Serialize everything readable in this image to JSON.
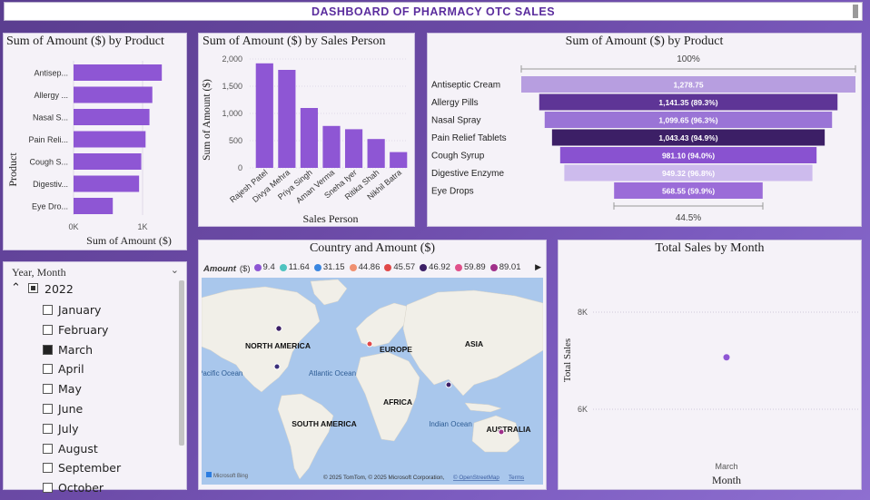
{
  "dashboard_title": "DASHBOARD OF PHARMACY OTC SALES",
  "bar_product": {
    "title": "Sum of Amount ($) by Product",
    "ylabel": "Product",
    "xlabel": "Sum of Amount ($)",
    "ticks": [
      "0K",
      "1K"
    ],
    "categories": [
      "Antisep...",
      "Allergy ...",
      "Nasal S...",
      "Pain Reli...",
      "Cough S...",
      "Digestiv...",
      "Eye Dro..."
    ],
    "values": [
      1278.75,
      1141.35,
      1099.65,
      1043.43,
      981.1,
      949.32,
      568.55
    ],
    "color": "#8e56d4"
  },
  "bar_salesperson": {
    "title": "Sum of Amount ($) by Sales Person",
    "ylabel": "Sum of Amount ($)",
    "xlabel": "Sales Person",
    "yticks": [
      "2,000",
      "1,500",
      "1,000",
      "500",
      "0"
    ],
    "categories": [
      "Rajesh Patel",
      "Divya Mehra",
      "Priya Singh",
      "Aman Verma",
      "Sneha Iyer",
      "Ritika Shah",
      "Nikhil Batra"
    ],
    "values": [
      1920,
      1800,
      1100,
      770,
      710,
      530,
      290
    ],
    "color": "#8e56d4"
  },
  "funnel": {
    "title": "Sum of Amount ($) by Product",
    "top_label": "100%",
    "bottom_label": "44.5%",
    "items": [
      {
        "name": "Antiseptic Cream",
        "label": "1,278.75",
        "value": 1278.75,
        "color": "#b79ee0"
      },
      {
        "name": "Allergy Pills",
        "label": "1,141.35 (89.3%)",
        "value": 1141.35,
        "color": "#5e3596"
      },
      {
        "name": "Nasal Spray",
        "label": "1,099.65 (96.3%)",
        "value": 1099.65,
        "color": "#9a74d6"
      },
      {
        "name": "Pain Relief Tablets",
        "label": "1,043.43 (94.9%)",
        "value": 1043.43,
        "color": "#3c1f66"
      },
      {
        "name": "Cough Syrup",
        "label": "981.10 (94.0%)",
        "value": 981.1,
        "color": "#8952d0"
      },
      {
        "name": "Digestive Enzyme",
        "label": "949.32 (96.8%)",
        "value": 949.32,
        "color": "#cdbbed"
      },
      {
        "name": "Eye Drops",
        "label": "568.55 (59.9%)",
        "value": 568.55,
        "color": "#9b6cd8"
      }
    ]
  },
  "map": {
    "title": "Country and Amount ($)",
    "legend_title": "Amount",
    "legend_unit": "($)",
    "legend": [
      {
        "label": "9.4",
        "color": "#8e56d4"
      },
      {
        "label": "11.64",
        "color": "#4fc3c0"
      },
      {
        "label": "31.15",
        "color": "#3a86e0"
      },
      {
        "label": "44.86",
        "color": "#f09070"
      },
      {
        "label": "45.57",
        "color": "#e04848"
      },
      {
        "label": "46.92",
        "color": "#3c1f66"
      },
      {
        "label": "59.89",
        "color": "#e0508a"
      },
      {
        "label": "89.01",
        "color": "#a0308a"
      }
    ],
    "regions": [
      "NORTH AMERICA",
      "EUROPE",
      "ASIA",
      "AFRICA",
      "SOUTH AMERICA",
      "AUSTRALIA"
    ],
    "oceans": [
      "Pacific Ocean",
      "Atlantic Ocean",
      "Indian Ocean"
    ],
    "brand": "Microsoft Bing",
    "attribution": "© 2025 TomTom, © 2025 Microsoft Corporation,",
    "osm": "© OpenStreetMap",
    "terms": "Terms"
  },
  "line_month": {
    "title": "Total Sales by Month",
    "ylabel": "Total Sales",
    "xlabel": "Month",
    "yticks": [
      "8K",
      "6K"
    ],
    "xtick": "March",
    "points": [
      {
        "x": "March",
        "y": 7070
      }
    ],
    "ylim": [
      5500,
      8500
    ],
    "color": "#8e56d4"
  },
  "slicer": {
    "title": "Year, Month",
    "year": "2022",
    "months": [
      {
        "label": "January",
        "checked": false
      },
      {
        "label": "February",
        "checked": false
      },
      {
        "label": "March",
        "checked": true
      },
      {
        "label": "April",
        "checked": false
      },
      {
        "label": "May",
        "checked": false
      },
      {
        "label": "June",
        "checked": false
      },
      {
        "label": "July",
        "checked": false
      },
      {
        "label": "August",
        "checked": false
      },
      {
        "label": "September",
        "checked": false
      },
      {
        "label": "October",
        "checked": false
      }
    ]
  }
}
